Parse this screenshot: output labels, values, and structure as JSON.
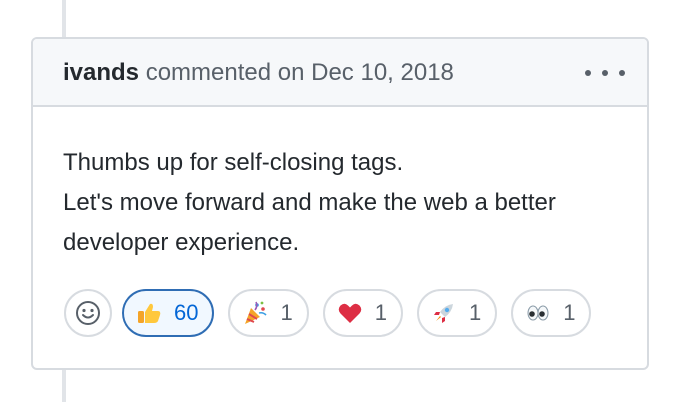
{
  "comment": {
    "author": "ivands",
    "meta": "commented on Dec 10, 2018",
    "more_icon": "kebab-horizontal-icon",
    "body_lines": [
      "Thumbs up for self-closing tags.",
      "Let's move forward and make the web a better",
      "developer experience."
    ]
  },
  "reactions": {
    "add_icon": "smiley-icon",
    "items": [
      {
        "icon": "thumbs-up",
        "count": "60",
        "selected": true
      },
      {
        "icon": "party-popper",
        "count": "1",
        "selected": false
      },
      {
        "icon": "heart",
        "count": "1",
        "selected": false
      },
      {
        "icon": "rocket",
        "count": "1",
        "selected": false
      },
      {
        "icon": "eyes",
        "count": "1",
        "selected": false
      }
    ]
  },
  "colors": {
    "border": "#d7dbe0",
    "header_bg": "#f6f8fa",
    "selected_border": "#2f6db4",
    "selected_bg": "#f1f8ff",
    "link_blue": "#0366d6"
  }
}
